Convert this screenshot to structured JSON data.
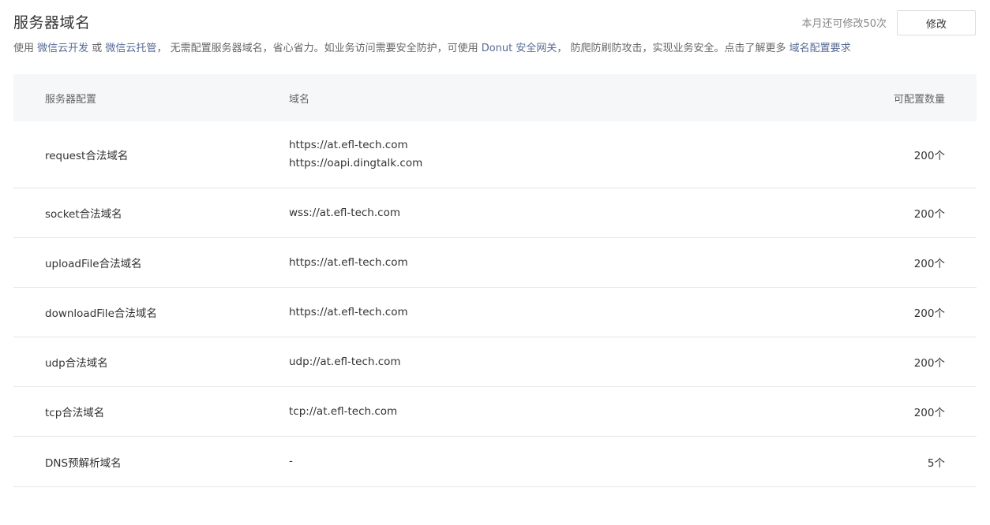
{
  "header": {
    "title": "服务器域名",
    "quota_text": "本月还可修改50次",
    "modify_label": "修改"
  },
  "description": {
    "prefix": "使用 ",
    "link1": "微信云开发",
    "or": " 或 ",
    "link2": "微信云托管",
    "middle": "， 无需配置服务器域名，省心省力。如业务访问需要安全防护，可使用 ",
    "link3": "Donut 安全网关",
    "suffix": "， 防爬防刷防攻击，实现业务安全。点击了解更多 ",
    "link4": "域名配置要求"
  },
  "table": {
    "headers": [
      "服务器配置",
      "域名",
      "可配置数量"
    ],
    "rows": [
      {
        "name": "request合法域名",
        "domains": [
          "https://at.efl-tech.com",
          "https://oapi.dingtalk.com"
        ],
        "count": "200个"
      },
      {
        "name": "socket合法域名",
        "domains": [
          "wss://at.efl-tech.com"
        ],
        "count": "200个"
      },
      {
        "name": "uploadFile合法域名",
        "domains": [
          "https://at.efl-tech.com"
        ],
        "count": "200个"
      },
      {
        "name": "downloadFile合法域名",
        "domains": [
          "https://at.efl-tech.com"
        ],
        "count": "200个"
      },
      {
        "name": "udp合法域名",
        "domains": [
          "udp://at.efl-tech.com"
        ],
        "count": "200个"
      },
      {
        "name": "tcp合法域名",
        "domains": [
          "tcp://at.efl-tech.com"
        ],
        "count": "200个"
      },
      {
        "name": "DNS预解析域名",
        "domains": [
          "-"
        ],
        "count": "5个"
      }
    ]
  }
}
